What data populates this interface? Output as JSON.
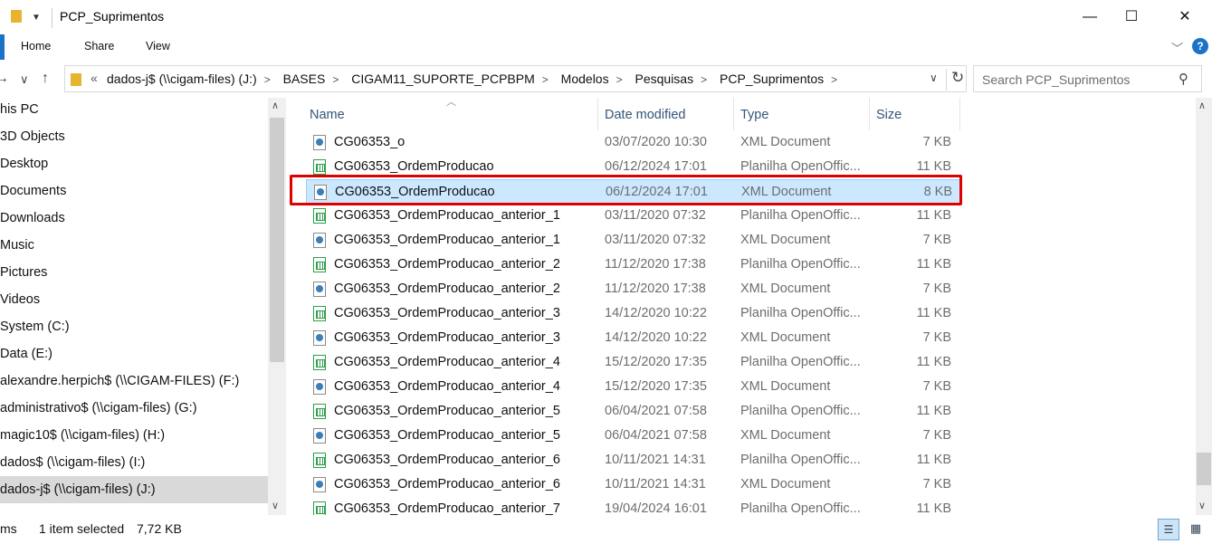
{
  "window": {
    "title": "PCP_Suprimentos",
    "controls": {
      "minimize": "—",
      "maximize": "☐",
      "close": "✕"
    }
  },
  "ribbon": {
    "tabs": [
      "Home",
      "Share",
      "View"
    ],
    "help": "?"
  },
  "address": {
    "overflow": "«",
    "crumbs": [
      "dados-j$ (\\\\cigam-files) (J:)",
      "BASES",
      "CIGAM11_SUPORTE_PCPBPM",
      "Modelos",
      "Pesquisas",
      "PCP_Suprimentos"
    ],
    "search_placeholder": "Search PCP_Suprimentos"
  },
  "sidebar": {
    "items": [
      "his PC",
      "3D Objects",
      "Desktop",
      "Documents",
      "Downloads",
      "Music",
      "Pictures",
      "Videos",
      "System (C:)",
      "Data (E:)",
      "alexandre.herpich$ (\\\\CIGAM-FILES) (F:)",
      "administrativo$ (\\\\cigam-files) (G:)",
      "magic10$ (\\\\cigam-files) (H:)",
      "dados$ (\\\\cigam-files) (I:)",
      "dados-j$ (\\\\cigam-files) (J:)"
    ],
    "selected_index": 14
  },
  "columns": {
    "name": "Name",
    "date": "Date modified",
    "type": "Type",
    "size": "Size"
  },
  "files": [
    {
      "name": "CG06353_o",
      "date": "03/07/2020 10:30",
      "type": "XML Document",
      "size": "7 KB",
      "icon": "xml-file-icon"
    },
    {
      "name": "CG06353_OrdemProducao",
      "date": "06/12/2024 17:01",
      "type": "Planilha OpenOffic...",
      "size": "11 KB",
      "icon": "spreadsheet-file-icon"
    },
    {
      "name": "CG06353_OrdemProducao",
      "date": "06/12/2024 17:01",
      "type": "XML Document",
      "size": "8 KB",
      "icon": "xml-file-icon"
    },
    {
      "name": "CG06353_OrdemProducao_anterior_1",
      "date": "03/11/2020 07:32",
      "type": "Planilha OpenOffic...",
      "size": "11 KB",
      "icon": "spreadsheet-file-icon"
    },
    {
      "name": "CG06353_OrdemProducao_anterior_1",
      "date": "03/11/2020 07:32",
      "type": "XML Document",
      "size": "7 KB",
      "icon": "xml-file-icon"
    },
    {
      "name": "CG06353_OrdemProducao_anterior_2",
      "date": "11/12/2020 17:38",
      "type": "Planilha OpenOffic...",
      "size": "11 KB",
      "icon": "spreadsheet-file-icon"
    },
    {
      "name": "CG06353_OrdemProducao_anterior_2",
      "date": "11/12/2020 17:38",
      "type": "XML Document",
      "size": "7 KB",
      "icon": "xml-file-icon"
    },
    {
      "name": "CG06353_OrdemProducao_anterior_3",
      "date": "14/12/2020 10:22",
      "type": "Planilha OpenOffic...",
      "size": "11 KB",
      "icon": "spreadsheet-file-icon"
    },
    {
      "name": "CG06353_OrdemProducao_anterior_3",
      "date": "14/12/2020 10:22",
      "type": "XML Document",
      "size": "7 KB",
      "icon": "xml-file-icon"
    },
    {
      "name": "CG06353_OrdemProducao_anterior_4",
      "date": "15/12/2020 17:35",
      "type": "Planilha OpenOffic...",
      "size": "11 KB",
      "icon": "spreadsheet-file-icon"
    },
    {
      "name": "CG06353_OrdemProducao_anterior_4",
      "date": "15/12/2020 17:35",
      "type": "XML Document",
      "size": "7 KB",
      "icon": "xml-file-icon"
    },
    {
      "name": "CG06353_OrdemProducao_anterior_5",
      "date": "06/04/2021 07:58",
      "type": "Planilha OpenOffic...",
      "size": "11 KB",
      "icon": "spreadsheet-file-icon"
    },
    {
      "name": "CG06353_OrdemProducao_anterior_5",
      "date": "06/04/2021 07:58",
      "type": "XML Document",
      "size": "7 KB",
      "icon": "xml-file-icon"
    },
    {
      "name": "CG06353_OrdemProducao_anterior_6",
      "date": "10/11/2021 14:31",
      "type": "Planilha OpenOffic...",
      "size": "11 KB",
      "icon": "spreadsheet-file-icon"
    },
    {
      "name": "CG06353_OrdemProducao_anterior_6",
      "date": "10/11/2021 14:31",
      "type": "XML Document",
      "size": "7 KB",
      "icon": "xml-file-icon"
    },
    {
      "name": "CG06353_OrdemProducao_anterior_7",
      "date": "19/04/2024 16:01",
      "type": "Planilha OpenOffic...",
      "size": "11 KB",
      "icon": "spreadsheet-file-icon"
    }
  ],
  "selected_file_index": 2,
  "status": {
    "items": "ms",
    "selected": "1 item selected",
    "size": "7,72 KB"
  },
  "colors": {
    "accent": "#1a73c7",
    "selection": "#cce8ff",
    "highlight_box": "#e00000"
  }
}
